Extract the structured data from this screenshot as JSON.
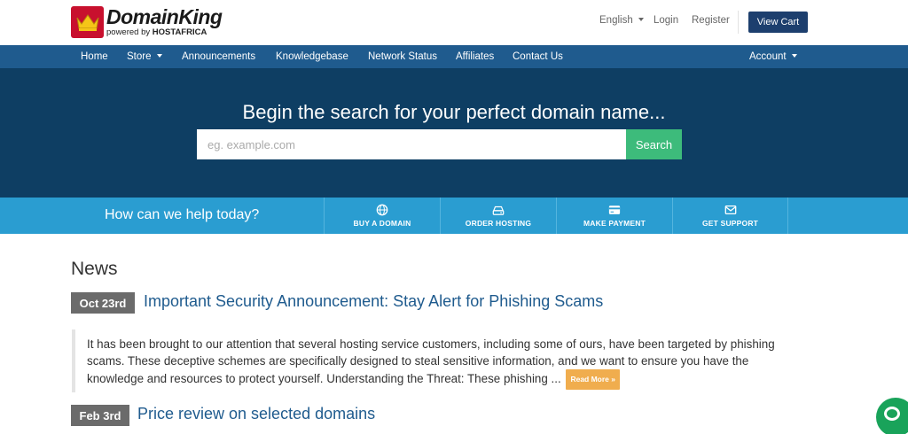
{
  "header": {
    "logo": {
      "name": "DomainKing",
      "powered_by": "powered by",
      "company": "HOSTAFRICA"
    },
    "language": "English",
    "login": "Login",
    "register": "Register",
    "view_cart": "View Cart"
  },
  "nav": {
    "items": [
      "Home",
      "Store",
      "Announcements",
      "Knowledgebase",
      "Network Status",
      "Affiliates",
      "Contact Us"
    ],
    "account": "Account"
  },
  "hero": {
    "title": "Begin the search for your perfect domain name...",
    "search_placeholder": "eg. example.com",
    "search_button": "Search"
  },
  "help": {
    "title": "How can we help today?",
    "items": [
      {
        "label": "BUY A DOMAIN",
        "icon": "globe-icon"
      },
      {
        "label": "ORDER HOSTING",
        "icon": "server-icon"
      },
      {
        "label": "MAKE PAYMENT",
        "icon": "credit-card-icon"
      },
      {
        "label": "GET SUPPORT",
        "icon": "envelope-icon"
      }
    ]
  },
  "news": {
    "heading": "News",
    "items": [
      {
        "date": "Oct 23rd",
        "title": "Important Security Announcement: Stay Alert for Phishing Scams",
        "excerpt": "It has been brought to our attention that several hosting service customers, including some of ours, have been targeted by phishing scams. These deceptive schemes are specifically designed to steal sensitive information, and we want to ensure you have the knowledge and resources to protect yourself. Understanding the Threat: These phishing ...",
        "read_more": "Read More »"
      },
      {
        "date": "Feb 3rd",
        "title": "Price review on selected domains"
      }
    ]
  },
  "colors": {
    "nav": "#1f5b8e",
    "hero": "#0e3e63",
    "help": "#2a9dd1",
    "search_button": "#3dbb7b",
    "view_cart": "#1d3f6e",
    "read_more": "#f0ad4e",
    "chat": "#19a35a"
  }
}
